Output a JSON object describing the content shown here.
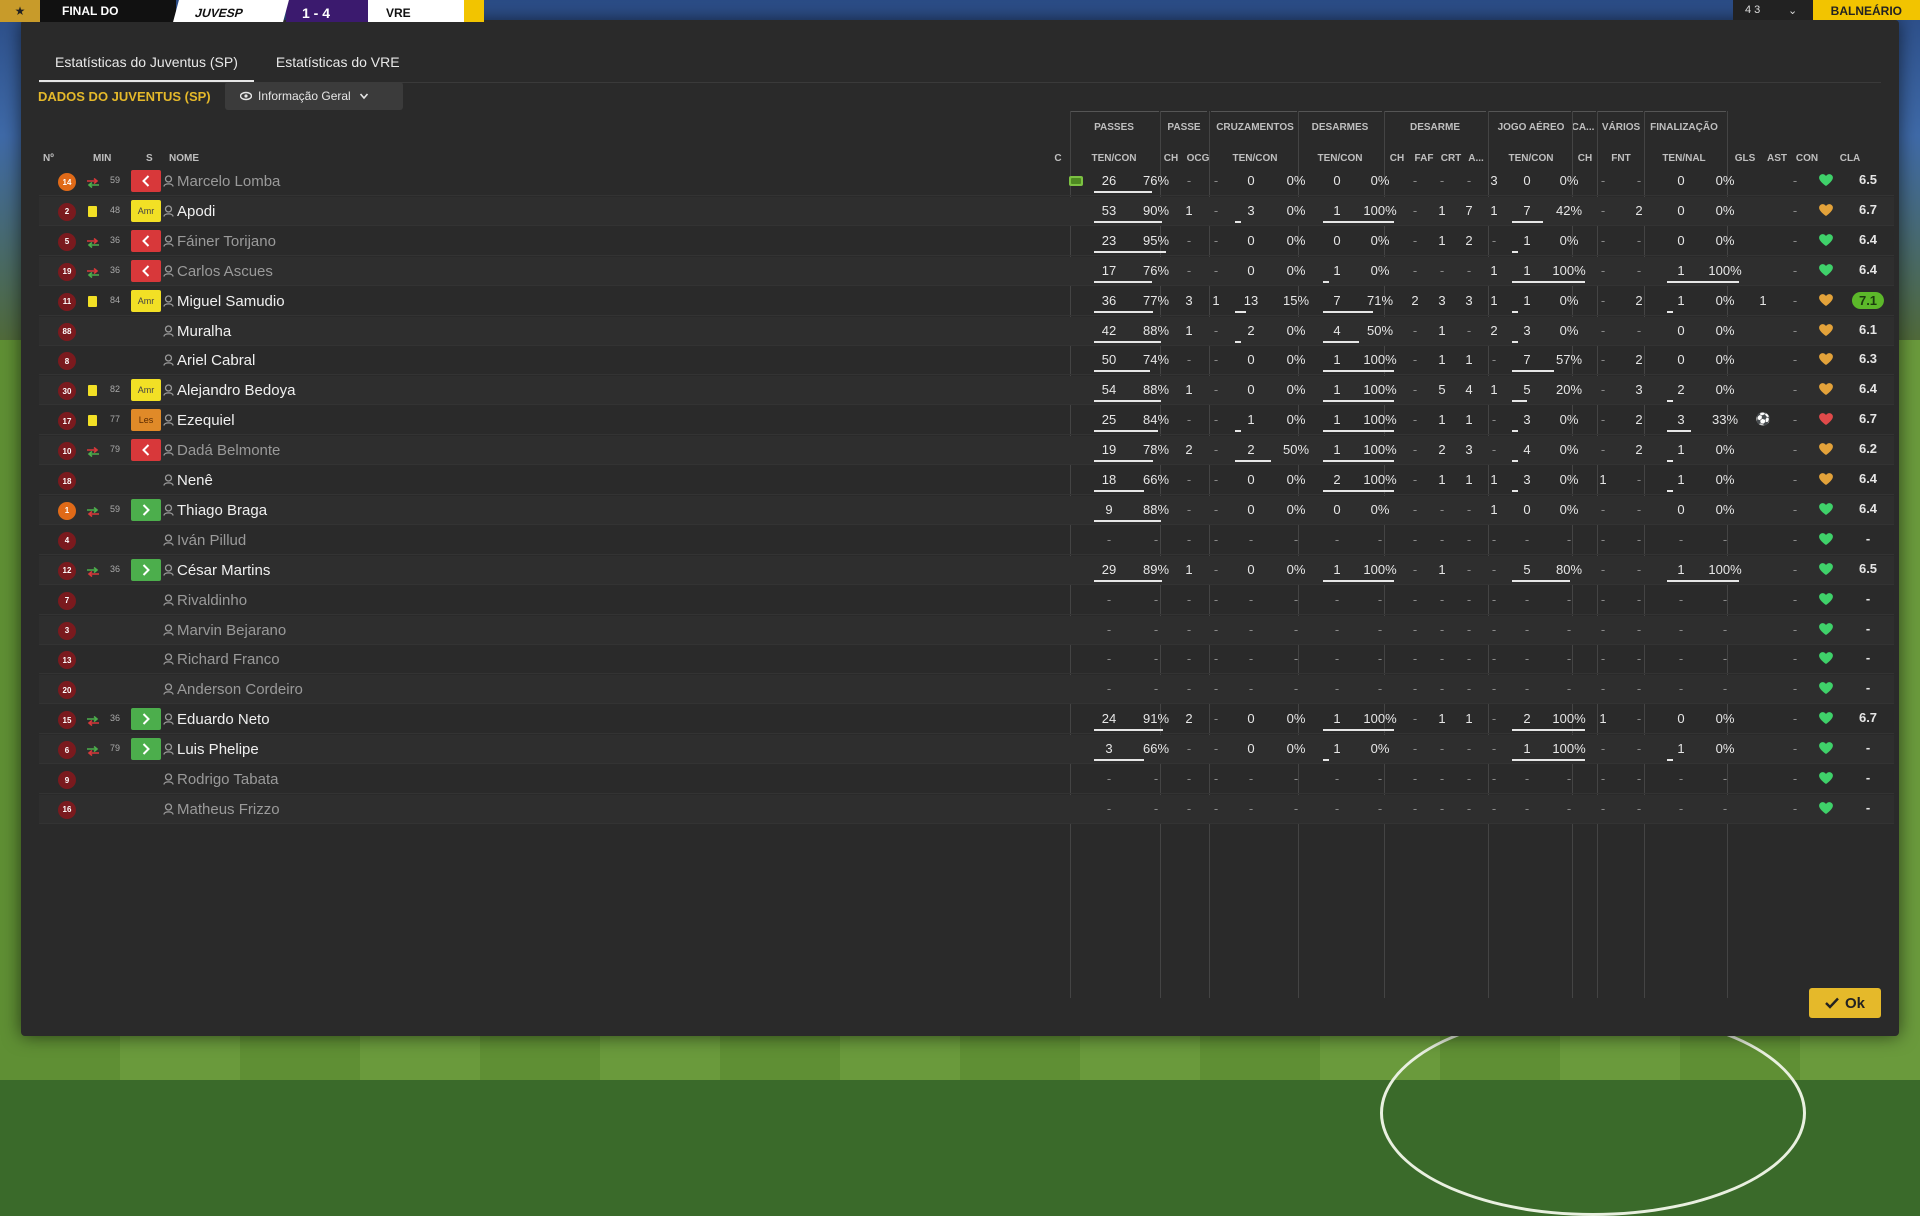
{
  "scoreboard": {
    "title": "FINAL DO",
    "home": "JUVESP",
    "score": "1 - 4",
    "away": "VRE",
    "corner_button": "BALNEÁRIO",
    "mini_score": "4 3"
  },
  "tabs": [
    "Estatísticas do Juventus (SP)",
    "Estatísticas do VRE"
  ],
  "section_title": "DADOS DO JUVENTUS (SP)",
  "view_dropdown": "Informação Geral",
  "group_headers": [
    "PASSES",
    "PASSE",
    "CRUZAMENTOS",
    "DESARMES",
    "DESARME",
    "JOGO AÉREO",
    "CA...",
    "VÁRIOS",
    "FINALIZAÇÃO"
  ],
  "column_headers": [
    "Nº",
    "MIN",
    "S",
    "NOME",
    "C",
    "TEN/CON",
    "CH",
    "OCG",
    "TEN/CON",
    "TEN/CON",
    "CH",
    "FAF",
    "CRT",
    "A...",
    "TEN/CON",
    "CH",
    "FNT",
    "TEN/NAL",
    "GLS",
    "AST",
    "CON",
    "CLA"
  ],
  "rows": [
    {
      "num": "14",
      "badge": "orange",
      "card": "",
      "min": "59",
      "sub": "out",
      "name": "Marcelo Lomba",
      "dim": true,
      "c": "green",
      "v": [
        "26",
        "76%",
        "-",
        "-",
        "0",
        "0%",
        "0",
        "0%",
        "-",
        "-",
        "-",
        "3",
        "0",
        "0%",
        "-",
        "-",
        "0",
        "0%",
        "",
        "-"
      ],
      "heart": "green",
      "rating": "6.5"
    },
    {
      "num": "2",
      "badge": "",
      "card": "yellow",
      "min": "48",
      "sub": "amr",
      "name": "Apodi",
      "dim": false,
      "c": "",
      "v": [
        "53",
        "90%",
        "1",
        "-",
        "3",
        "0%",
        "1",
        "100%",
        "-",
        "1",
        "7",
        "1",
        "7",
        "42%",
        "-",
        "2",
        "0",
        "0%",
        "",
        "-"
      ],
      "heart": "orange",
      "rating": "6.7"
    },
    {
      "num": "5",
      "badge": "",
      "card": "",
      "min": "36",
      "sub": "out",
      "name": "Fáiner Torijano",
      "dim": true,
      "c": "",
      "v": [
        "23",
        "95%",
        "-",
        "-",
        "0",
        "0%",
        "0",
        "0%",
        "-",
        "1",
        "2",
        "-",
        "1",
        "0%",
        "-",
        "-",
        "0",
        "0%",
        "",
        "-"
      ],
      "heart": "green",
      "rating": "6.4"
    },
    {
      "num": "19",
      "badge": "",
      "card": "",
      "min": "36",
      "sub": "out",
      "name": "Carlos Ascues",
      "dim": true,
      "c": "",
      "v": [
        "17",
        "76%",
        "-",
        "-",
        "0",
        "0%",
        "1",
        "0%",
        "-",
        "-",
        "-",
        "1",
        "1",
        "100%",
        "-",
        "-",
        "1",
        "100%",
        "",
        "-"
      ],
      "heart": "green",
      "rating": "6.4"
    },
    {
      "num": "11",
      "badge": "",
      "card": "yellow",
      "min": "84",
      "sub": "amr",
      "name": "Miguel Samudio",
      "dim": false,
      "c": "",
      "v": [
        "36",
        "77%",
        "3",
        "1",
        "13",
        "15%",
        "7",
        "71%",
        "2",
        "3",
        "3",
        "1",
        "1",
        "0%",
        "-",
        "2",
        "1",
        "0%",
        "1",
        "-"
      ],
      "heart": "orange",
      "rating": "7.1"
    },
    {
      "num": "88",
      "badge": "",
      "card": "",
      "min": "",
      "sub": "",
      "name": "Muralha",
      "dim": false,
      "c": "",
      "v": [
        "42",
        "88%",
        "1",
        "-",
        "2",
        "0%",
        "4",
        "50%",
        "-",
        "1",
        "-",
        "2",
        "3",
        "0%",
        "-",
        "-",
        "0",
        "0%",
        "",
        "-"
      ],
      "heart": "orange",
      "rating": "6.1"
    },
    {
      "num": "8",
      "badge": "",
      "card": "",
      "min": "",
      "sub": "",
      "name": "Ariel Cabral",
      "dim": false,
      "c": "",
      "v": [
        "50",
        "74%",
        "-",
        "-",
        "0",
        "0%",
        "1",
        "100%",
        "-",
        "1",
        "1",
        "-",
        "7",
        "57%",
        "-",
        "2",
        "0",
        "0%",
        "",
        "-"
      ],
      "heart": "orange",
      "rating": "6.3"
    },
    {
      "num": "30",
      "badge": "",
      "card": "yellow",
      "min": "82",
      "sub": "amr",
      "name": "Alejandro Bedoya",
      "dim": false,
      "c": "",
      "v": [
        "54",
        "88%",
        "1",
        "-",
        "0",
        "0%",
        "1",
        "100%",
        "-",
        "5",
        "4",
        "1",
        "5",
        "20%",
        "-",
        "3",
        "2",
        "0%",
        "",
        "-"
      ],
      "heart": "orange",
      "rating": "6.4"
    },
    {
      "num": "17",
      "badge": "",
      "card": "yellow",
      "min": "77",
      "sub": "les",
      "name": "Ezequiel",
      "dim": false,
      "c": "",
      "v": [
        "25",
        "84%",
        "-",
        "-",
        "1",
        "0%",
        "1",
        "100%",
        "-",
        "1",
        "1",
        "-",
        "3",
        "0%",
        "-",
        "2",
        "3",
        "33%",
        "ball",
        "-"
      ],
      "heart": "red",
      "rating": "6.7"
    },
    {
      "num": "10",
      "badge": "",
      "card": "",
      "min": "79",
      "sub": "out",
      "name": "Dadá Belmonte",
      "dim": true,
      "c": "",
      "v": [
        "19",
        "78%",
        "2",
        "-",
        "2",
        "50%",
        "1",
        "100%",
        "-",
        "2",
        "3",
        "-",
        "4",
        "0%",
        "-",
        "2",
        "1",
        "0%",
        "",
        "-"
      ],
      "heart": "orange",
      "rating": "6.2"
    },
    {
      "num": "18",
      "badge": "",
      "card": "",
      "min": "",
      "sub": "",
      "name": "Nenê",
      "dim": false,
      "c": "",
      "v": [
        "18",
        "66%",
        "-",
        "-",
        "0",
        "0%",
        "2",
        "100%",
        "-",
        "1",
        "1",
        "1",
        "3",
        "0%",
        "1",
        "-",
        "1",
        "0%",
        "",
        "-"
      ],
      "heart": "orange",
      "rating": "6.4"
    },
    {
      "num": "1",
      "badge": "orange",
      "card": "",
      "min": "59",
      "sub": "in",
      "name": "Thiago Braga",
      "dim": false,
      "c": "",
      "v": [
        "9",
        "88%",
        "-",
        "-",
        "0",
        "0%",
        "0",
        "0%",
        "-",
        "-",
        "-",
        "1",
        "0",
        "0%",
        "-",
        "-",
        "0",
        "0%",
        "",
        "-"
      ],
      "heart": "green",
      "rating": "6.4"
    },
    {
      "num": "4",
      "badge": "",
      "card": "",
      "min": "",
      "sub": "",
      "name": "Iván Pillud",
      "dim": true,
      "c": "",
      "v": [
        "-",
        "-",
        "-",
        "-",
        "-",
        "-",
        "-",
        "-",
        "-",
        "-",
        "-",
        "-",
        "-",
        "-",
        "-",
        "-",
        "-",
        "-",
        "",
        "-"
      ],
      "heart": "green",
      "rating": "-"
    },
    {
      "num": "12",
      "badge": "",
      "card": "",
      "min": "36",
      "sub": "in",
      "name": "César Martins",
      "dim": false,
      "c": "",
      "v": [
        "29",
        "89%",
        "1",
        "-",
        "0",
        "0%",
        "1",
        "100%",
        "-",
        "1",
        "-",
        "-",
        "5",
        "80%",
        "-",
        "-",
        "1",
        "100%",
        "",
        "-"
      ],
      "heart": "green",
      "rating": "6.5"
    },
    {
      "num": "7",
      "badge": "",
      "card": "",
      "min": "",
      "sub": "",
      "name": "Rivaldinho",
      "dim": true,
      "c": "",
      "v": [
        "-",
        "-",
        "-",
        "-",
        "-",
        "-",
        "-",
        "-",
        "-",
        "-",
        "-",
        "-",
        "-",
        "-",
        "-",
        "-",
        "-",
        "-",
        "",
        "-"
      ],
      "heart": "green",
      "rating": "-"
    },
    {
      "num": "3",
      "badge": "",
      "card": "",
      "min": "",
      "sub": "",
      "name": "Marvin Bejarano",
      "dim": true,
      "c": "",
      "v": [
        "-",
        "-",
        "-",
        "-",
        "-",
        "-",
        "-",
        "-",
        "-",
        "-",
        "-",
        "-",
        "-",
        "-",
        "-",
        "-",
        "-",
        "-",
        "",
        "-"
      ],
      "heart": "green",
      "rating": "-"
    },
    {
      "num": "13",
      "badge": "",
      "card": "",
      "min": "",
      "sub": "",
      "name": "Richard Franco",
      "dim": true,
      "c": "",
      "v": [
        "-",
        "-",
        "-",
        "-",
        "-",
        "-",
        "-",
        "-",
        "-",
        "-",
        "-",
        "-",
        "-",
        "-",
        "-",
        "-",
        "-",
        "-",
        "",
        "-"
      ],
      "heart": "green",
      "rating": "-"
    },
    {
      "num": "20",
      "badge": "",
      "card": "",
      "min": "",
      "sub": "",
      "name": "Anderson Cordeiro",
      "dim": true,
      "c": "",
      "v": [
        "-",
        "-",
        "-",
        "-",
        "-",
        "-",
        "-",
        "-",
        "-",
        "-",
        "-",
        "-",
        "-",
        "-",
        "-",
        "-",
        "-",
        "-",
        "",
        "-"
      ],
      "heart": "green",
      "rating": "-"
    },
    {
      "num": "15",
      "badge": "",
      "card": "",
      "min": "36",
      "sub": "in",
      "name": "Eduardo Neto",
      "dim": false,
      "c": "",
      "v": [
        "24",
        "91%",
        "2",
        "-",
        "0",
        "0%",
        "1",
        "100%",
        "-",
        "1",
        "1",
        "-",
        "2",
        "100%",
        "1",
        "-",
        "0",
        "0%",
        "",
        "-"
      ],
      "heart": "green",
      "rating": "6.7"
    },
    {
      "num": "6",
      "badge": "",
      "card": "",
      "min": "79",
      "sub": "in",
      "name": "Luis Phelipe",
      "dim": false,
      "c": "",
      "v": [
        "3",
        "66%",
        "-",
        "-",
        "0",
        "0%",
        "1",
        "0%",
        "-",
        "-",
        "-",
        "-",
        "1",
        "100%",
        "-",
        "-",
        "1",
        "0%",
        "",
        "-"
      ],
      "heart": "green",
      "rating": "-"
    },
    {
      "num": "9",
      "badge": "",
      "card": "",
      "min": "",
      "sub": "",
      "name": "Rodrigo Tabata",
      "dim": true,
      "c": "",
      "v": [
        "-",
        "-",
        "-",
        "-",
        "-",
        "-",
        "-",
        "-",
        "-",
        "-",
        "-",
        "-",
        "-",
        "-",
        "-",
        "-",
        "-",
        "-",
        "",
        "-"
      ],
      "heart": "green",
      "rating": "-"
    },
    {
      "num": "16",
      "badge": "",
      "card": "",
      "min": "",
      "sub": "",
      "name": "Matheus Frizzo",
      "dim": true,
      "c": "",
      "v": [
        "-",
        "-",
        "-",
        "-",
        "-",
        "-",
        "-",
        "-",
        "-",
        "-",
        "-",
        "-",
        "-",
        "-",
        "-",
        "-",
        "-",
        "-",
        "",
        "-"
      ],
      "heart": "green",
      "rating": "-"
    }
  ],
  "ok_label": "Ok",
  "colors": {
    "accent": "#e5b92a",
    "modal_bg": "#2a2a2a",
    "sub_out": "#d8383a",
    "sub_in": "#4cae4c",
    "yellow_card": "#f2e025",
    "best_rating": "#5cb82a"
  }
}
